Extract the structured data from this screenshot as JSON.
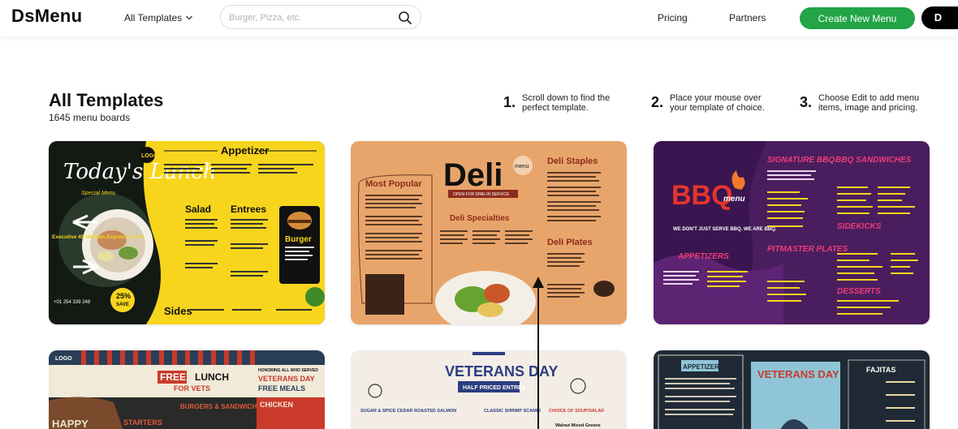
{
  "header": {
    "logo": "DsMenu",
    "templates_dropdown": "All Templates",
    "search_placeholder": "Burger, Pizza, etc.",
    "pricing": "Pricing",
    "partners": "Partners",
    "create_button": "Create New Menu",
    "avatar_initial": "D"
  },
  "page": {
    "title": "All Templates",
    "count": "1645 menu boards"
  },
  "steps": [
    {
      "num": "1.",
      "text": "Scroll down to find the perfect template."
    },
    {
      "num": "2.",
      "text": "Place your mouse over your template of choice."
    },
    {
      "num": "3.",
      "text": "Choose Edit to add menu items, image and pricing."
    }
  ],
  "cards": {
    "lunch": {
      "script_title": "Today's Lunch",
      "special": "Special Menu",
      "logo": "LOGO",
      "appetizer": "Appetizer",
      "salad": "Salad",
      "entrees": "Entrees",
      "burger": "Burger",
      "sides": "Sides",
      "executive": "Executive 45 Minutes Express Lunch",
      "badge_pct": "25%",
      "badge_save": "SAVE",
      "phone": "+01 254 339 248"
    },
    "deli": {
      "title": "Deli",
      "menu_tag": "menu",
      "open": "OPEN FOR DINE-IN SERVICE",
      "most_popular": "Most Popular",
      "deli_staples": "Deli Staples",
      "deli_specialties": "Deli Specialties",
      "deli_plates": "Deli Plates"
    },
    "bbq": {
      "signature": "SIGNATURE BBQ",
      "sandwiches": "BBQ SANDWICHES",
      "logo_bbq": "BBQ",
      "logo_menu": "menu",
      "tagline": "WE DON'T JUST SERVE BBQ. WE ARE BBQ.",
      "appetizers": "APPETIZERS",
      "pitmaster": "PITMASTER PLATES",
      "sidekicks": "SIDEKICKS",
      "desserts": "DESSERTS"
    },
    "vets_lunch": {
      "logo": "LOGO",
      "free": "FREE",
      "lunch": "LUNCH",
      "for_vets": "FOR VETS",
      "honoring": "HONORING ALL WHO SERVED",
      "veterans_day": "VETERANS DAY",
      "free_meals": "FREE MEALS",
      "burgers": "BURGERS & SANDWICHES",
      "chicken": "CHICKEN",
      "starters": "STARTERS",
      "happy": "HAPPY"
    },
    "veterans": {
      "title": "VETERANS DAY",
      "half_price": "HALF PRICED ENTRÉE",
      "salmon": "SUGAR & SPICE CEDAR ROASTED SALMON",
      "shrimp": "CLASSIC SHRIMP SCAMPI",
      "soup": "CHOICE OF SOUP/SALAD",
      "walnut": "Walnut Mixed Greens"
    },
    "fajitas": {
      "appetizers": "APPETIZERS",
      "veterans_day": "VETERANS DAY",
      "fajitas": "FAJITAS"
    }
  },
  "colors": {
    "brand_green": "#22a447",
    "lunch_yellow": "#f7d51c",
    "deli_tan": "#e8a56b",
    "bbq_purple": "#4a1e5e",
    "fajitas_navy": "#1f2a36"
  }
}
